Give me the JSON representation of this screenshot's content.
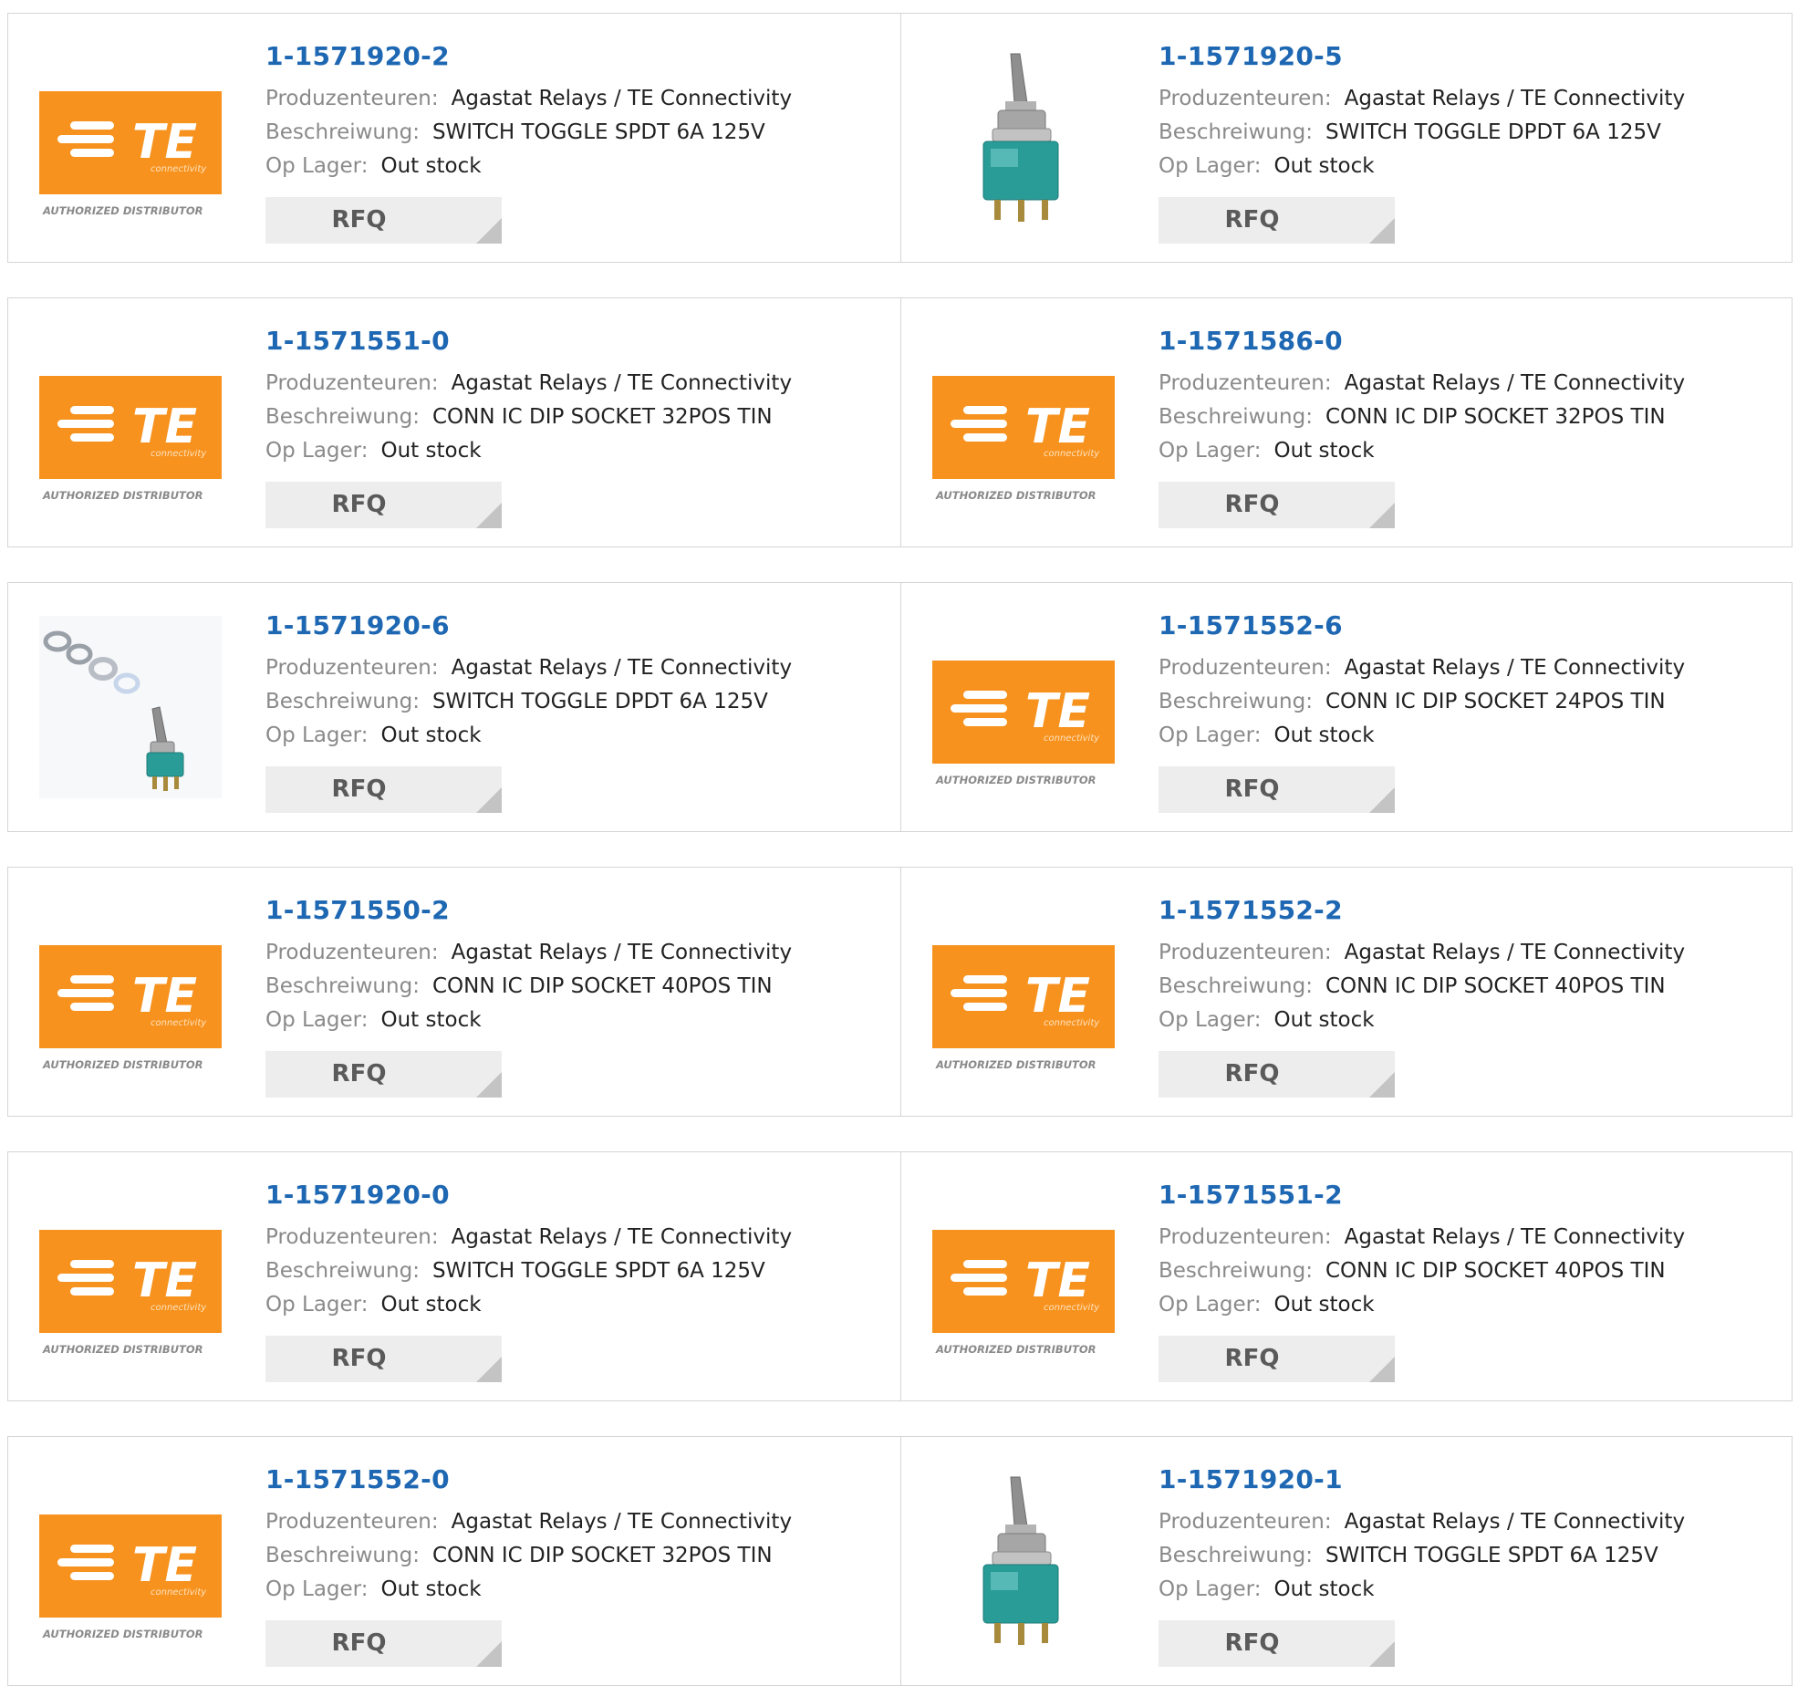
{
  "labels": {
    "manufacturer": "Produzenteuren:",
    "description": "Beschreiwung:",
    "stock": "Op Lager:",
    "rfq": "RFQ"
  },
  "logo": {
    "brand": "TE",
    "tagline": "connectivity",
    "caption": "AUTHORIZED DISTRIBUTOR",
    "color": "#f7921e"
  },
  "products": [
    {
      "part": "1-1571920-2",
      "manufacturer": "Agastat Relays / TE Connectivity",
      "description": "SWITCH TOGGLE SPDT 6A 125V",
      "stock": "Out stock",
      "image": "te-logo"
    },
    {
      "part": "1-1571920-5",
      "manufacturer": "Agastat Relays / TE Connectivity",
      "description": "SWITCH TOGGLE DPDT 6A 125V",
      "stock": "Out stock",
      "image": "toggle-switch"
    },
    {
      "part": "1-1571551-0",
      "manufacturer": "Agastat Relays / TE Connectivity",
      "description": "CONN IC DIP SOCKET 32POS TIN",
      "stock": "Out stock",
      "image": "te-logo"
    },
    {
      "part": "1-1571586-0",
      "manufacturer": "Agastat Relays / TE Connectivity",
      "description": "CONN IC DIP SOCKET 32POS TIN",
      "stock": "Out stock",
      "image": "te-logo"
    },
    {
      "part": "1-1571920-6",
      "manufacturer": "Agastat Relays / TE Connectivity",
      "description": "SWITCH TOGGLE DPDT 6A 125V",
      "stock": "Out stock",
      "image": "toggle-switch-kit"
    },
    {
      "part": "1-1571552-6",
      "manufacturer": "Agastat Relays / TE Connectivity",
      "description": "CONN IC DIP SOCKET 24POS TIN",
      "stock": "Out stock",
      "image": "te-logo"
    },
    {
      "part": "1-1571550-2",
      "manufacturer": "Agastat Relays / TE Connectivity",
      "description": "CONN IC DIP SOCKET 40POS TIN",
      "stock": "Out stock",
      "image": "te-logo"
    },
    {
      "part": "1-1571552-2",
      "manufacturer": "Agastat Relays / TE Connectivity",
      "description": "CONN IC DIP SOCKET 40POS TIN",
      "stock": "Out stock",
      "image": "te-logo"
    },
    {
      "part": "1-1571920-0",
      "manufacturer": "Agastat Relays / TE Connectivity",
      "description": "SWITCH TOGGLE SPDT 6A 125V",
      "stock": "Out stock",
      "image": "te-logo"
    },
    {
      "part": "1-1571551-2",
      "manufacturer": "Agastat Relays / TE Connectivity",
      "description": "CONN IC DIP SOCKET 40POS TIN",
      "stock": "Out stock",
      "image": "te-logo"
    },
    {
      "part": "1-1571552-0",
      "manufacturer": "Agastat Relays / TE Connectivity",
      "description": "CONN IC DIP SOCKET 32POS TIN",
      "stock": "Out stock",
      "image": "te-logo"
    },
    {
      "part": "1-1571920-1",
      "manufacturer": "Agastat Relays / TE Connectivity",
      "description": "SWITCH TOGGLE SPDT 6A 125V",
      "stock": "Out stock",
      "image": "toggle-switch"
    }
  ]
}
